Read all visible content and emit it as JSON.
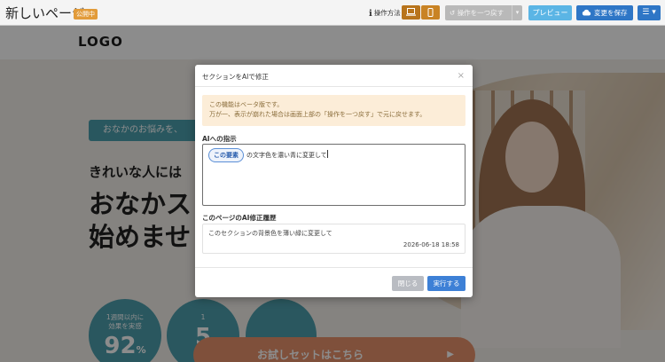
{
  "toolbar": {
    "page_title": "新しいページ",
    "status_badge": "公開中",
    "howto_label": "操作方法",
    "undo_label": "操作を一つ戻す",
    "preview_label": "プレビュー",
    "save_label": "変更を保存",
    "menu_label": "☰ ▾",
    "accent_color": "#c98324",
    "save_color": "#2e76c6"
  },
  "site": {
    "logo": "LOGO",
    "bubble_text": "おなかのお悩みを、",
    "tagline": "きれいな人には",
    "headline_line1": "おなかス",
    "headline_line2": "始めませ",
    "stats": [
      {
        "text1": "1週間以内に",
        "text2": "効果を実感",
        "value": "92",
        "unit": "%"
      },
      {
        "text1": "1",
        "text2": "",
        "value": "5",
        "unit": ""
      }
    ],
    "cta": "お試しセットはこちら",
    "cta_arrow": "▶"
  },
  "modal": {
    "title": "セクションをAIで修正",
    "close_symbol": "×",
    "notice_line1": "この機能はベータ版です。",
    "notice_line2": "万が一、表示が崩れた場合は画面上部の「操作を一つ戻す」で元に戻せます。",
    "instruction_label": "AIへの指示",
    "element_chip": "この要素",
    "instruction_text": "の文字色を濃い青に変更して",
    "history_label": "このページのAI修正履歴",
    "history": {
      "text": "このセクションの背景色を薄い緑に変更して",
      "time": "2026-06-18 18:58"
    },
    "cancel_label": "閉じる",
    "run_label": "実行する"
  }
}
